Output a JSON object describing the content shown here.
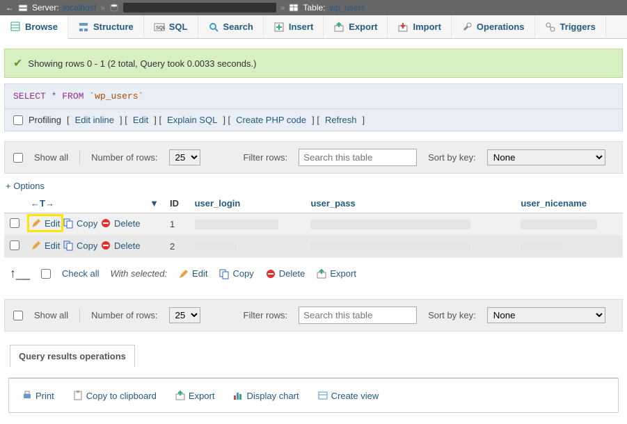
{
  "breadcrumb": {
    "server_label": "Server:",
    "server_value": "localhost",
    "table_label": "Table:",
    "table_value": "wp_users"
  },
  "tabs": [
    {
      "id": "browse",
      "label": "Browse"
    },
    {
      "id": "structure",
      "label": "Structure"
    },
    {
      "id": "sql",
      "label": "SQL"
    },
    {
      "id": "search",
      "label": "Search"
    },
    {
      "id": "insert",
      "label": "Insert"
    },
    {
      "id": "export",
      "label": "Export"
    },
    {
      "id": "import",
      "label": "Import"
    },
    {
      "id": "operations",
      "label": "Operations"
    },
    {
      "id": "triggers",
      "label": "Triggers"
    }
  ],
  "success_msg": "Showing rows 0 - 1 (2 total, Query took 0.0033 seconds.)",
  "query": {
    "select": "SELECT",
    "star": "*",
    "from": "FROM",
    "table": "`wp_users`"
  },
  "links": {
    "profiling": "Profiling",
    "edit_inline": "Edit inline",
    "edit": "Edit",
    "explain": "Explain SQL",
    "php": "Create PHP code",
    "refresh": "Refresh"
  },
  "controls": {
    "show_all": "Show all",
    "rows_label": "Number of rows:",
    "rows_value": "25",
    "filter_label": "Filter rows:",
    "filter_placeholder": "Search this table",
    "sort_label": "Sort by key:",
    "sort_value": "None"
  },
  "options_label": "+ Options",
  "table": {
    "cols": [
      "ID",
      "user_login",
      "user_pass",
      "user_nicename"
    ],
    "rows": [
      {
        "id": "1"
      },
      {
        "id": "2"
      }
    ],
    "actions": {
      "edit": "Edit",
      "copy": "Copy",
      "delete": "Delete"
    }
  },
  "bulk": {
    "check_all": "Check all",
    "with_selected": "With selected:",
    "edit": "Edit",
    "copy": "Copy",
    "delete": "Delete",
    "export": "Export"
  },
  "qro": {
    "title": "Query results operations",
    "print": "Print",
    "clipboard": "Copy to clipboard",
    "export": "Export",
    "chart": "Display chart",
    "view": "Create view"
  }
}
